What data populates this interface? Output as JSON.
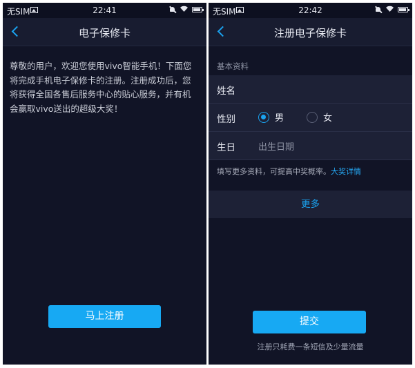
{
  "left": {
    "status": {
      "carrier": "无SIM",
      "time": "22:41"
    },
    "nav": {
      "title": "电子保修卡"
    },
    "intro": "尊敬的用户，欢迎您使用vivo智能手机！下面您将完成手机电子保修卡的注册。注册成功后，您将获得全国各售后服务中心的贴心服务，并有机会赢取vivo送出的超级大奖！",
    "register_button": "马上注册"
  },
  "right": {
    "status": {
      "carrier": "无SIM",
      "time": "22:42"
    },
    "nav": {
      "title": "注册电子保修卡"
    },
    "section_title": "基本资料",
    "name_label": "姓名",
    "gender_label": "性别",
    "gender_options": [
      {
        "label": "男",
        "selected": true
      },
      {
        "label": "女",
        "selected": false
      }
    ],
    "birth_label": "生日",
    "birth_placeholder": "出生日期",
    "hint_text": "填写更多资料，可提高中奖概率。",
    "hint_link": "大奖详情",
    "more_label": "更多",
    "submit_button": "提交",
    "footnote": "注册只耗费一条短信及少量流量"
  },
  "icons": [
    "back-arrow-icon",
    "picture-icon",
    "mute-icon",
    "wifi-icon",
    "battery-icon",
    "radio-icon"
  ],
  "colors": {
    "background": "#111426",
    "accent": "#17a9f3",
    "row": "#1d2136"
  }
}
